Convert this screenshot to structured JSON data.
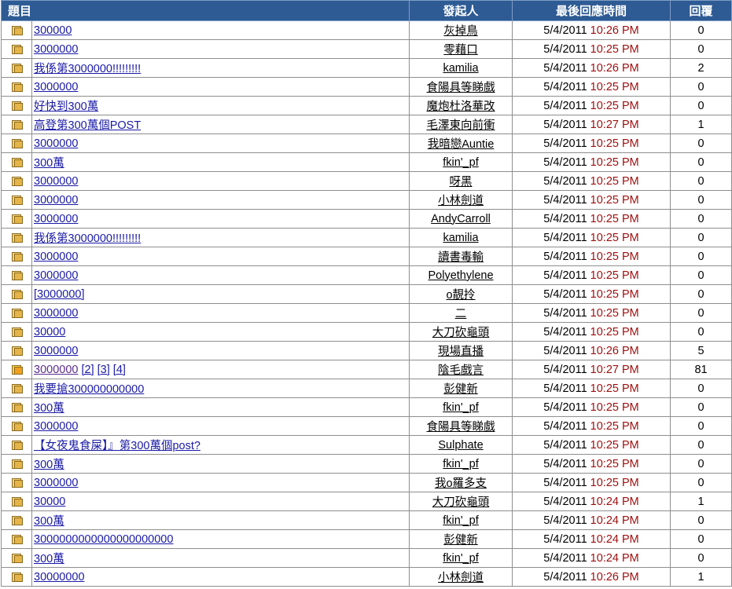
{
  "headers": {
    "title": "題目",
    "author": "發起人",
    "last_reply": "最後回應時間",
    "replies": "回覆"
  },
  "rows": [
    {
      "title": "300000",
      "author": "灰掉鳥",
      "date": "5/4/2011",
      "time": "10:26 PM",
      "replies": "0",
      "icon": "folder-icon"
    },
    {
      "title": "3000000",
      "author": "零藉口",
      "date": "5/4/2011",
      "time": "10:25 PM",
      "replies": "0",
      "icon": "folder-icon"
    },
    {
      "title": "我係第3000000!!!!!!!!!",
      "author": "kamilia",
      "date": "5/4/2011",
      "time": "10:26 PM",
      "replies": "2",
      "icon": "folder-icon"
    },
    {
      "title": "3000000",
      "author": "食陽具等睇戲",
      "date": "5/4/2011",
      "time": "10:25 PM",
      "replies": "0",
      "icon": "folder-icon"
    },
    {
      "title": "好快到300萬",
      "author": "魔炮杜洛華改",
      "date": "5/4/2011",
      "time": "10:25 PM",
      "replies": "0",
      "icon": "folder-icon"
    },
    {
      "title": "高登第300萬個POST",
      "author": "毛澤東向前衝",
      "date": "5/4/2011",
      "time": "10:27 PM",
      "replies": "1",
      "icon": "folder-icon"
    },
    {
      "title": "3000000",
      "author": "我暗戀Auntie",
      "date": "5/4/2011",
      "time": "10:25 PM",
      "replies": "0",
      "icon": "folder-icon"
    },
    {
      "title": "300萬",
      "author": "fkin'_pf",
      "date": "5/4/2011",
      "time": "10:25 PM",
      "replies": "0",
      "icon": "folder-icon"
    },
    {
      "title": "3000000",
      "author": "呀黑",
      "date": "5/4/2011",
      "time": "10:25 PM",
      "replies": "0",
      "icon": "folder-icon"
    },
    {
      "title": "3000000",
      "author": "小林劍道",
      "date": "5/4/2011",
      "time": "10:25 PM",
      "replies": "0",
      "icon": "folder-icon"
    },
    {
      "title": "3000000",
      "author": "AndyCarroll",
      "date": "5/4/2011",
      "time": "10:25 PM",
      "replies": "0",
      "icon": "folder-icon"
    },
    {
      "title": "我係第3000000!!!!!!!!!",
      "author": "kamilia",
      "date": "5/4/2011",
      "time": "10:25 PM",
      "replies": "0",
      "icon": "folder-icon"
    },
    {
      "title": "3000000",
      "author": "讀書毒輸",
      "date": "5/4/2011",
      "time": "10:25 PM",
      "replies": "0",
      "icon": "folder-icon"
    },
    {
      "title": "3000000",
      "author": "Polyethylene",
      "date": "5/4/2011",
      "time": "10:25 PM",
      "replies": "0",
      "icon": "folder-icon"
    },
    {
      "title": "[3000000]",
      "author": "o靚拎",
      "date": "5/4/2011",
      "time": "10:25 PM",
      "replies": "0",
      "icon": "folder-icon"
    },
    {
      "title": "3000000",
      "author": "二",
      "date": "5/4/2011",
      "time": "10:25 PM",
      "replies": "0",
      "icon": "folder-icon"
    },
    {
      "title": "30000",
      "author": "大刀砍龜頭",
      "date": "5/4/2011",
      "time": "10:25 PM",
      "replies": "0",
      "icon": "folder-icon"
    },
    {
      "title": "3000000",
      "author": "現場直播",
      "date": "5/4/2011",
      "time": "10:26 PM",
      "replies": "5",
      "icon": "folder-icon"
    },
    {
      "title": "3000000",
      "author": "陰毛戲言",
      "date": "5/4/2011",
      "time": "10:27 PM",
      "replies": "81",
      "icon": "hot-folder-icon",
      "visited": true,
      "pages": [
        "[2]",
        "[3]",
        "[4]"
      ]
    },
    {
      "title": "我要搶300000000000",
      "author": "彭健新",
      "date": "5/4/2011",
      "time": "10:25 PM",
      "replies": "0",
      "icon": "folder-icon"
    },
    {
      "title": "300萬",
      "author": "fkin'_pf",
      "date": "5/4/2011",
      "time": "10:25 PM",
      "replies": "0",
      "icon": "folder-icon"
    },
    {
      "title": "3000000",
      "author": "食陽具等睇戲",
      "date": "5/4/2011",
      "time": "10:25 PM",
      "replies": "0",
      "icon": "folder-icon"
    },
    {
      "title": "【女夜鬼食屎】』第300萬個post?",
      "author": "Sulphate",
      "date": "5/4/2011",
      "time": "10:25 PM",
      "replies": "0",
      "icon": "folder-icon"
    },
    {
      "title": "300萬",
      "author": "fkin'_pf",
      "date": "5/4/2011",
      "time": "10:25 PM",
      "replies": "0",
      "icon": "folder-icon"
    },
    {
      "title": "3000000",
      "author": "我o羅多支",
      "date": "5/4/2011",
      "time": "10:25 PM",
      "replies": "0",
      "icon": "folder-icon"
    },
    {
      "title": "30000",
      "author": "大刀砍龜頭",
      "date": "5/4/2011",
      "time": "10:24 PM",
      "replies": "1",
      "icon": "folder-icon"
    },
    {
      "title": "300萬",
      "author": "fkin'_pf",
      "date": "5/4/2011",
      "time": "10:24 PM",
      "replies": "0",
      "icon": "folder-icon"
    },
    {
      "title": "3000000000000000000000",
      "author": "彭健新",
      "date": "5/4/2011",
      "time": "10:24 PM",
      "replies": "0",
      "icon": "folder-icon"
    },
    {
      "title": "300萬",
      "author": "fkin'_pf",
      "date": "5/4/2011",
      "time": "10:24 PM",
      "replies": "0",
      "icon": "folder-icon"
    },
    {
      "title": "30000000",
      "author": "小林劍道",
      "date": "5/4/2011",
      "time": "10:26 PM",
      "replies": "1",
      "icon": "folder-icon"
    }
  ]
}
